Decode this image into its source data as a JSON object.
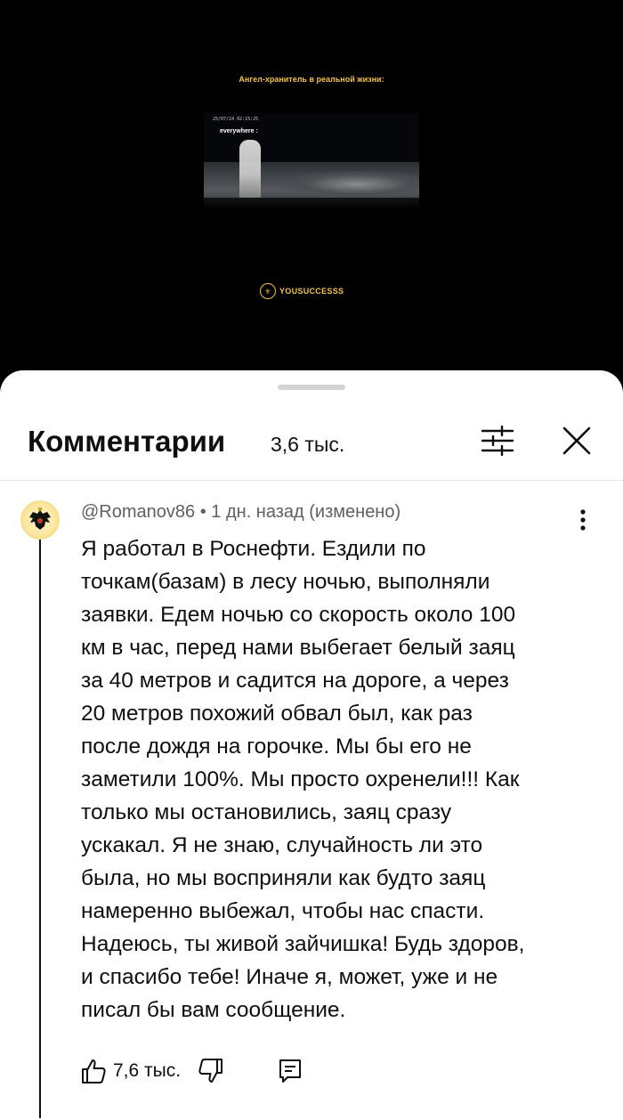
{
  "video": {
    "caption": "Ангел-хранитель в реальной жизни:",
    "timestamp": "25/07/24 02:15:25",
    "subtitle": "everywhere :",
    "brand": "YOUSUCCESSS"
  },
  "comments_panel": {
    "title": "Комментарии",
    "count": "3,6 тыс."
  },
  "comment": {
    "author": "@Romanov86",
    "separator": "•",
    "time": "1 дн. назад (изменено)",
    "text": "Я работал в Роснефти. Ездили по\nточкам(базам) в лесу ночью, выполняли\nзаявки. Едем ночью со скорость около 100\nкм в час, перед нами выбегает белый заяц\nза 40 метров и садится на дороге, а через\n20 метров похожий обвал был, как раз\nпосле дождя на горочке. Мы бы его не\nзаметили 100%. Мы просто охренели!!! Как\nтолько мы остановились, заяц сразу\nускакал. Я не знаю, случайность ли это\nбыла, но мы восприняли как будто заяц\nнамеренно выбежал,  чтобы нас спасти.\nНадеюсь, ты живой зайчишка! Будь здоров,\nи спасибо тебе! Иначе я, может, уже и не\nписал бы вам сообщение.",
    "likes": "7,6 тыс."
  },
  "icons": {
    "filter": "sliders-icon",
    "close": "close-icon",
    "more": "more-vert-icon",
    "like": "thumb-up-icon",
    "dislike": "thumb-down-icon",
    "reply": "reply-icon"
  }
}
